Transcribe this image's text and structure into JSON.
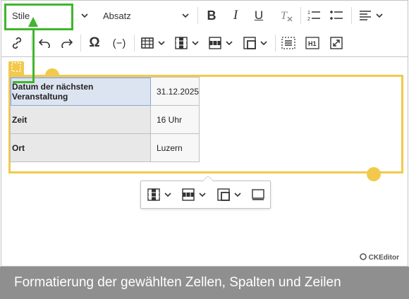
{
  "toolbar": {
    "style_label": "Stile",
    "heading_label": "Absatz"
  },
  "table": {
    "rows": [
      {
        "label": "Datum der nächsten Veranstaltung",
        "value": "31.12.2025"
      },
      {
        "label": "Zeit",
        "value": "16 Uhr"
      },
      {
        "label": "Ort",
        "value": "Luzern"
      }
    ]
  },
  "branding": {
    "text": "CKEditor"
  },
  "caption": {
    "text": "Formatierung der gewählten Zellen, Spalten und Zeilen"
  },
  "colors": {
    "highlight": "#3fb62c",
    "widget": "#f2c94c",
    "caption_bg": "#8f8f8f"
  }
}
